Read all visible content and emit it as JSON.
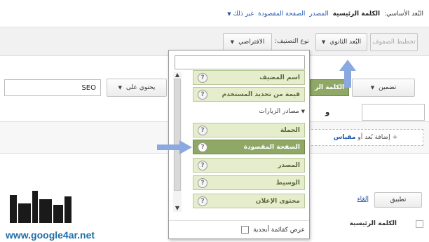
{
  "primary_dimension": {
    "label": "البُعد الأساسي:",
    "selected": "الكلمة الرئيسية",
    "links": [
      "المصدر",
      "الصفحة المقصودة"
    ],
    "more": "غير ذلك"
  },
  "toolbar": {
    "flatten_rows": "تخطيط الصفوف",
    "secondary_dimension": "البُعد الثانوي",
    "sort_type_label": "نوع التصنيف:",
    "sort_type_value": "الافتراضي"
  },
  "filter": {
    "include": "تضمين",
    "keyword_chip": "الكلمة الر",
    "contains": "يحتوي على",
    "value": "SEO",
    "and": "و"
  },
  "add_dimension": {
    "plus": "+",
    "text": "إضافة بُعد أو",
    "metric_link": "مقياس"
  },
  "actions": {
    "apply": "تطبيق",
    "cancel": "إلغاء"
  },
  "table": {
    "primary_column": "الكلمة الرئيسية"
  },
  "dropdown": {
    "search_value": "",
    "top_items": [
      "اسم المضيف",
      "قيمة من تحديد المستخدم"
    ],
    "group_name": "مصادر الزيارات",
    "group_items": [
      "الحملة",
      "الصفحة المقصودة",
      "المصدر",
      "الوسيط",
      "محتوى الإعلان"
    ],
    "active_item": "الصفحة المقصودة",
    "help_glyph": "?",
    "alphabetical": "عرض كقائمة أبجدية"
  },
  "watermark": {
    "url": "www.google4ar.net"
  },
  "colors": {
    "green_active": "#8fa866",
    "green_light": "#e5edcc",
    "link_blue": "#2255aa",
    "arrow_blue": "#8aa9e0"
  }
}
